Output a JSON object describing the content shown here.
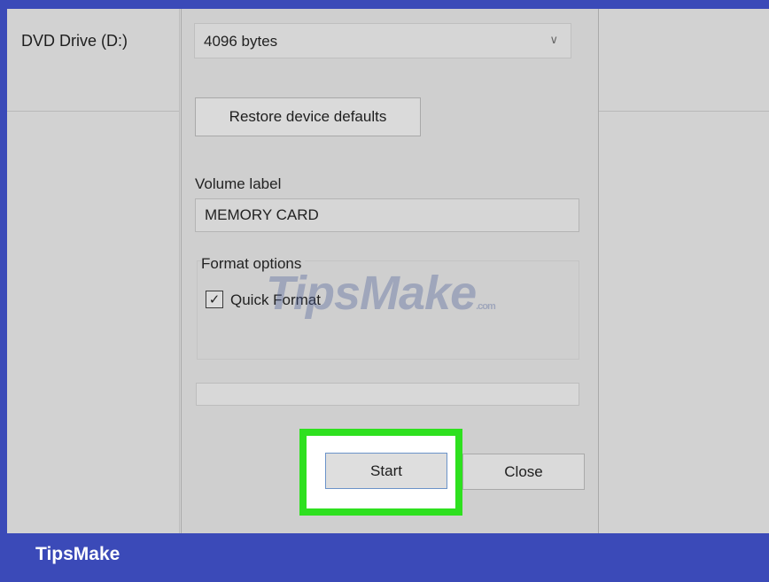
{
  "left_panel": {
    "drive_label": "DVD Drive (D:)"
  },
  "dialog": {
    "allocation_unit": {
      "value": "4096 bytes",
      "icon": "chevron-down-icon"
    },
    "restore_button": "Restore device defaults",
    "volume_label": {
      "label": "Volume label",
      "value": "MEMORY CARD"
    },
    "format_options": {
      "title": "Format options",
      "quick_format": {
        "label": "Quick Format",
        "checked": true
      }
    },
    "progress_percent": 0,
    "start_button": "Start",
    "close_button": "Close"
  },
  "watermark": {
    "text": "TipsMake",
    "suffix": ".com"
  },
  "footer": {
    "brand": "TipsMake"
  },
  "colors": {
    "highlight": "#2ee01f",
    "brand_bar": "#3b4ab8"
  }
}
